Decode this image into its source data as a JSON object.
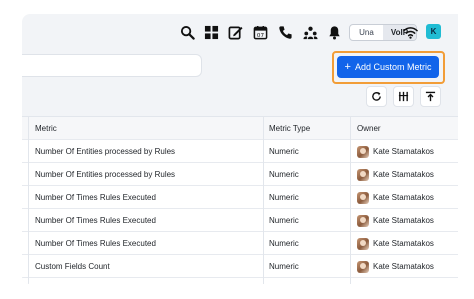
{
  "topbar": {
    "icons": [
      "search-icon",
      "apps-grid-icon",
      "edit-icon",
      "calendar-icon",
      "phone-icon",
      "team-icon",
      "bell-icon"
    ],
    "calendar_day": "07",
    "toggle": {
      "options": [
        "Una",
        "VoIP"
      ],
      "selected": "VoIP"
    },
    "wifi_icon": "wifi-icon",
    "user_initial": "K"
  },
  "search": {
    "placeholder": ""
  },
  "actions": {
    "add_label": "Add Custom Metric",
    "add_icon": "plus-icon",
    "highlight_color": "#f29d37",
    "primary_color": "#1264ea",
    "tools": [
      "refresh-icon",
      "columns-icon",
      "export-icon"
    ]
  },
  "table": {
    "headers": {
      "metric": "Metric",
      "type": "Metric Type",
      "owner": "Owner"
    },
    "rows": [
      {
        "metric": "Number Of Entities processed by Rules",
        "type": "Numeric",
        "owner": "Kate Stamatakos"
      },
      {
        "metric": "Number Of Entities processed by Rules",
        "type": "Numeric",
        "owner": "Kate Stamatakos"
      },
      {
        "metric": "Number Of Times Rules Executed",
        "type": "Numeric",
        "owner": "Kate Stamatakos"
      },
      {
        "metric": "Number Of Times Rules Executed",
        "type": "Numeric",
        "owner": "Kate Stamatakos"
      },
      {
        "metric": "Number Of Times Rules Executed",
        "type": "Numeric",
        "owner": "Kate Stamatakos"
      },
      {
        "metric": "Custom Fields Count",
        "type": "Numeric",
        "owner": "Kate Stamatakos"
      }
    ]
  }
}
